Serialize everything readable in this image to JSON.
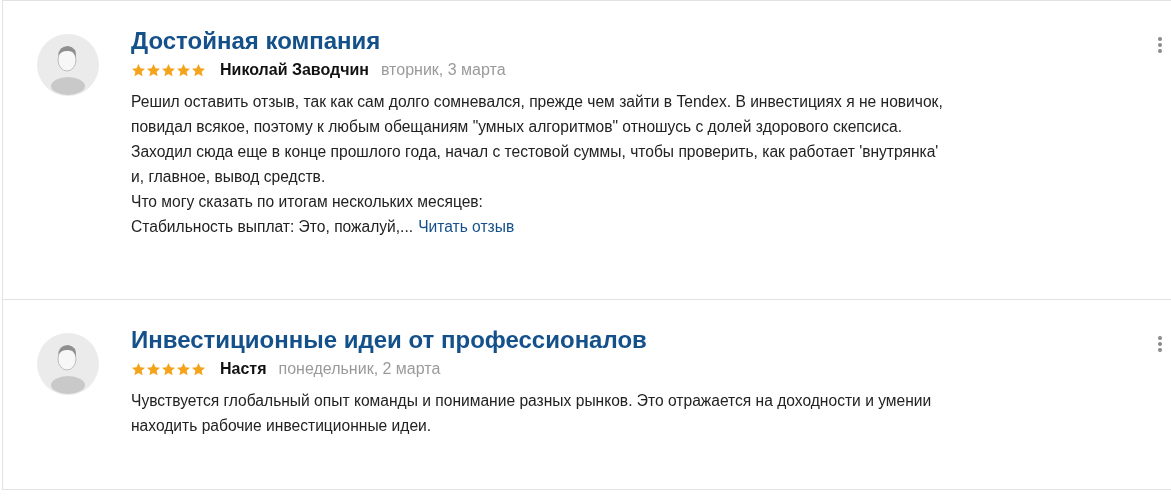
{
  "reviews": [
    {
      "title": "Достойная компания",
      "stars": 5,
      "author": "Николай Заводчин",
      "date": "вторник, 3 марта",
      "lines": [
        "Решил оставить отзыв, так как сам долго сомневался, прежде чем зайти в Tendex. В инвестициях я не новичок,",
        "повидал всякое, поэтому к любым обещаниям \"умных алгоритмов\" отношусь с долей здорового скепсиса.",
        "Заходил сюда еще в конце прошлого года, начал с тестовой суммы, чтобы проверить, как работает 'внутрянка'",
        "и, главное, вывод средств.",
        "Что могу сказать по итогам нескольких месяцев:",
        "Стабильность выплат: Это, пожалуй,..."
      ],
      "read_more": "Читать отзыв"
    },
    {
      "title": "Инвестиционные идеи от профессионалов",
      "stars": 5,
      "author": "Настя",
      "date": "понедельник, 2 марта",
      "lines": [
        "Чувствуется глобальный опыт команды и понимание разных рынков. Это отражается на доходности и умении",
        "находить рабочие инвестиционные идеи."
      ]
    }
  ]
}
